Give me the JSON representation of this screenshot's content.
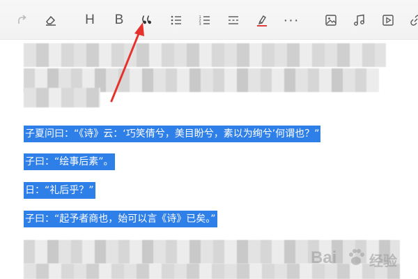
{
  "toolbar": {
    "items": [
      {
        "name": "redo-icon",
        "label": ""
      },
      {
        "name": "eraser-icon",
        "label": ""
      },
      {
        "name": "heading-button",
        "label": "H"
      },
      {
        "name": "bold-button",
        "label": "B"
      },
      {
        "name": "blockquote-icon",
        "label": ""
      },
      {
        "name": "bullet-list-icon",
        "label": ""
      },
      {
        "name": "numbered-list-icon",
        "label": ""
      },
      {
        "name": "divider-icon",
        "label": ""
      },
      {
        "name": "highlight-icon",
        "label": ""
      },
      {
        "name": "more-button",
        "label": "···"
      },
      {
        "name": "image-icon",
        "label": ""
      },
      {
        "name": "music-icon",
        "label": ""
      },
      {
        "name": "video-icon",
        "label": ""
      },
      {
        "name": "link-icon",
        "label": ""
      }
    ],
    "highlight_color": "#e23b3b"
  },
  "content": {
    "selected_lines": [
      "子夏问曰：“《诗》云：‘巧笑倩兮，美目盼兮，素以为绚兮’何谓也？”",
      "子曰：“绘事后素”。",
      "日：“礼后乎？”",
      "子曰：“起予者商也，始可以言《诗》已矣。”"
    ],
    "selection_color": "#2f7fe8"
  },
  "annotation": {
    "arrow_color": "#e5322d"
  },
  "watermark": {
    "brand": "Bai",
    "suffix": "经验"
  }
}
